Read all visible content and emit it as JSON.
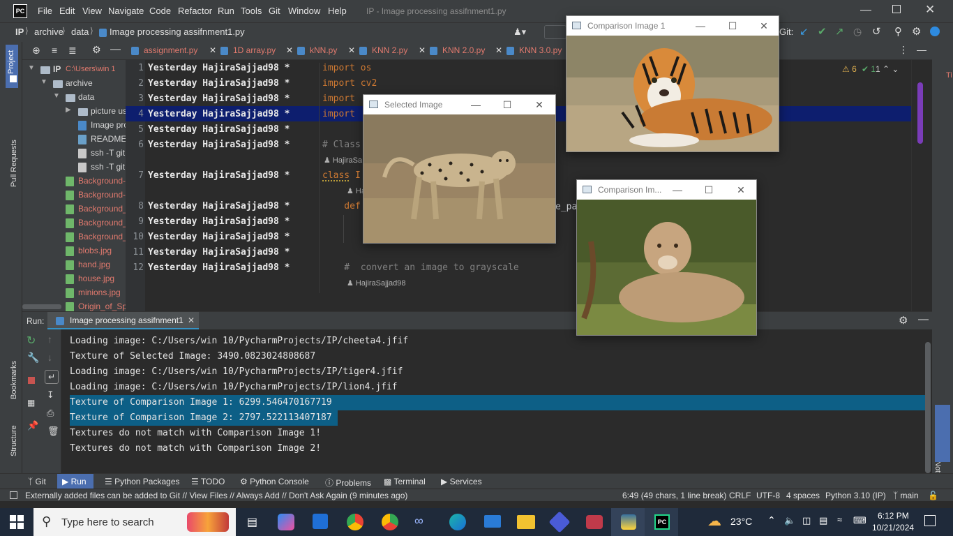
{
  "app": {
    "menus": [
      "File",
      "Edit",
      "View",
      "Navigate",
      "Code",
      "Refactor",
      "Run",
      "Tools",
      "Git",
      "Window",
      "Help"
    ],
    "window_title": "IP - Image processing assifnment1.py",
    "logo": "PC"
  },
  "nav": {
    "crumbs": [
      "IP",
      "archive",
      "data",
      "Image processing assifnment1.py"
    ],
    "git_label": "Git:"
  },
  "side_left": {
    "project": "Project",
    "pull_requests": "Pull Requests",
    "bookmarks": "Bookmarks",
    "structure": "Structure"
  },
  "side_right": {
    "notifications": "Notifications"
  },
  "project_tree": [
    {
      "label": "IP",
      "suffix": "C:\\Users\\win 1",
      "type": "folder",
      "level": 0
    },
    {
      "label": "archive",
      "type": "folder",
      "level": 1
    },
    {
      "label": "data",
      "type": "folder",
      "level": 2
    },
    {
      "label": "picture us",
      "type": "folder",
      "level": 3
    },
    {
      "label": "Image pro",
      "type": "py",
      "level": 3
    },
    {
      "label": "README.",
      "type": "md",
      "level": 3
    },
    {
      "label": "ssh -T git",
      "type": "file",
      "level": 3
    },
    {
      "label": "ssh -T git",
      "type": "file",
      "level": 3
    },
    {
      "label": "Background-",
      "type": "img-red",
      "level": 2
    },
    {
      "label": "Background-",
      "type": "img-red",
      "level": 2
    },
    {
      "label": "Background_",
      "type": "img-red",
      "level": 2
    },
    {
      "label": "Background_",
      "type": "img-red",
      "level": 2
    },
    {
      "label": "Background_",
      "type": "img-red",
      "level": 2
    },
    {
      "label": "blobs.jpg",
      "type": "img-red",
      "level": 2
    },
    {
      "label": "hand.jpg",
      "type": "img-red",
      "level": 2
    },
    {
      "label": "house.jpg",
      "type": "img-red",
      "level": 2
    },
    {
      "label": "minions.jpg",
      "type": "img-red",
      "level": 2
    },
    {
      "label": "Origin_of_Sp",
      "type": "img-red",
      "level": 2
    }
  ],
  "editor_tabs": [
    "assignment.py",
    "1D array.py",
    "kNN.py",
    "KNN 2.py",
    "KNN 2.0.py",
    "KNN 3.0.py"
  ],
  "inspections": {
    "warnings": "6",
    "ok": "1",
    "up": "1"
  },
  "code_lines": [
    {
      "n": "1",
      "blame": "Yesterday HajiraSajjad98 *",
      "code": "import os"
    },
    {
      "n": "2",
      "blame": "Yesterday HajiraSajjad98 *",
      "code": "import cv2"
    },
    {
      "n": "3",
      "blame": "Yesterday HajiraSajjad98 *",
      "code": "import "
    },
    {
      "n": "4",
      "blame": "Yesterday HajiraSajjad98 *",
      "code": "import "
    },
    {
      "n": "5",
      "blame": "Yesterday HajiraSajjad98 *",
      "code": ""
    },
    {
      "n": "6",
      "blame": "Yesterday HajiraSajjad98 *",
      "code": "# Class"
    },
    {
      "n": "7",
      "blame": "Yesterday HajiraSajjad98 *",
      "code": "class I"
    },
    {
      "n": "8",
      "blame": "Yesterday HajiraSajjad98 *",
      "code": "    def"
    },
    {
      "n": "9",
      "blame": "Yesterday HajiraSajjad98 *",
      "code": ""
    },
    {
      "n": "10",
      "blame": "Yesterday HajiraSajjad98 *",
      "code": ""
    },
    {
      "n": "11",
      "blame": "Yesterday HajiraSajjad98 *",
      "code": ""
    },
    {
      "n": "12",
      "blame": "Yesterday HajiraSajjad98 *",
      "code": "    #  convert an image to grayscale"
    }
  ],
  "hints": {
    "author1": "HajiraSa",
    "author2": "Ha",
    "author3": "HajiraSajjad98",
    "param_frag": "e_pa"
  },
  "run": {
    "label": "Run:",
    "tab": "Image processing assifnment1",
    "lines": [
      "Loading image: C:/Users/win 10/PycharmProjects/IP/cheeta4.jfif",
      "Texture of Selected Image: 3490.0823024808687",
      "Loading image: C:/Users/win 10/PycharmProjects/IP/tiger4.jfif",
      "Loading image: C:/Users/win 10/PycharmProjects/IP/lion4.jfif",
      "Texture of Comparison Image 1: 6299.546470167719",
      "Texture of Comparison Image 2: 2797.522113407187",
      "Textures do not match with Comparison Image 1!",
      "Textures do not match with Comparison Image 2!"
    ]
  },
  "bottom_tabs": [
    "Git",
    "Run",
    "Python Packages",
    "TODO",
    "Python Console",
    "Problems",
    "Terminal",
    "Services"
  ],
  "status": {
    "message": "Externally added files can be added to Git // View Files // Always Add // Don't Ask Again (9 minutes ago)",
    "position": "6:49 (49 chars, 1 line break)",
    "line_sep": "CRLF",
    "encoding": "UTF-8",
    "indent": "4 spaces",
    "interpreter": "Python 3.10 (IP)",
    "branch": "main"
  },
  "windows": {
    "selected": "Selected Image",
    "comp1": "Comparison Image 1",
    "comp2": "Comparison Im..."
  },
  "taskbar": {
    "search_placeholder": "Type here to search",
    "temp": "23°C",
    "time": "6:12 PM",
    "date": "10/21/2024"
  },
  "colors": {
    "ide_bg": "#2b2b2b",
    "panel": "#3c3f41",
    "keyword": "#cc7832",
    "selection": "#0d5f86",
    "current_line": "#0d1e6e"
  }
}
